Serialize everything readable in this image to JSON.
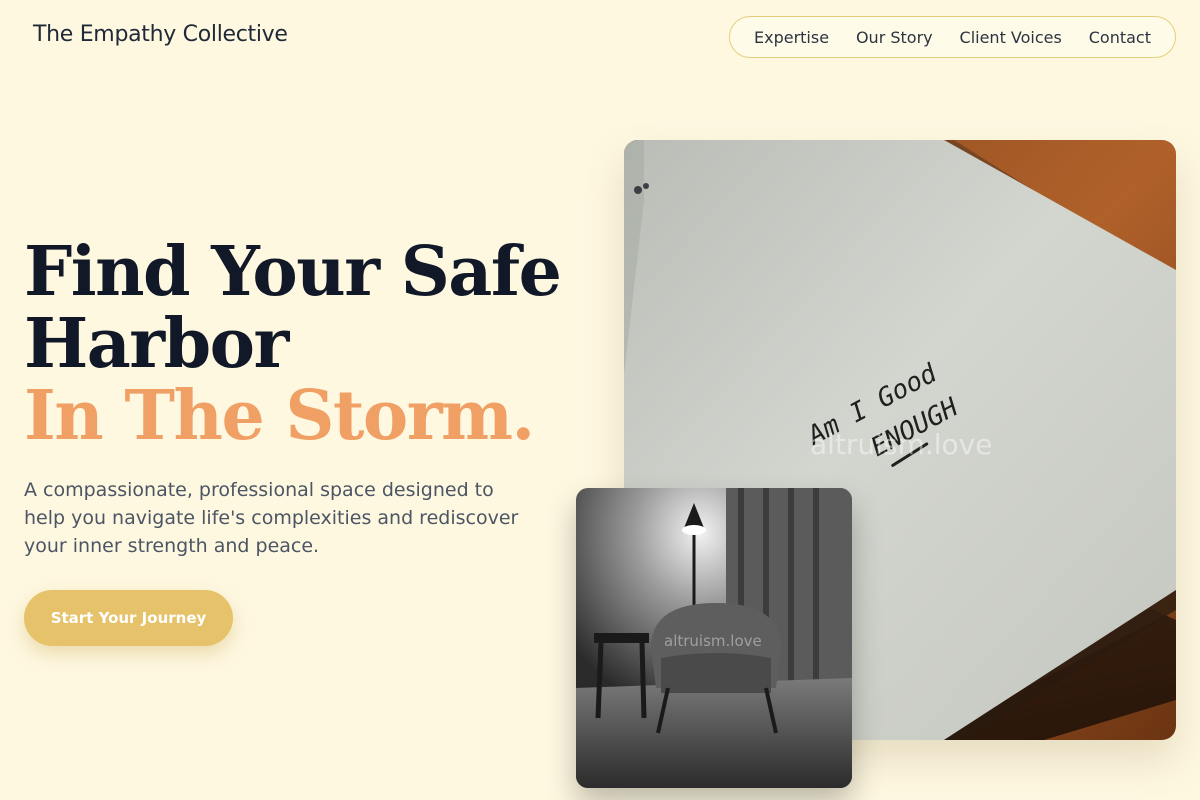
{
  "brand": {
    "name": "The Empathy Collective"
  },
  "nav": {
    "items": [
      {
        "label": "Expertise"
      },
      {
        "label": "Our Story"
      },
      {
        "label": "Client Voices"
      },
      {
        "label": "Contact"
      }
    ]
  },
  "hero": {
    "headline_line1": "Find Your Safe",
    "headline_line2": "Harbor",
    "headline_accent": "In The Storm.",
    "subtext": "A compassionate, professional space designed to help you navigate life's complexities and rediscover your inner strength and peace.",
    "cta_label": "Start Your Journey"
  },
  "images": {
    "main_handwriting_line1": "Am I Good",
    "main_handwriting_line2": "ENOUGH",
    "main_watermark": "altruism.love",
    "small_watermark": "altruism.love"
  },
  "colors": {
    "background": "#fef8e1",
    "accent": "#f0a064",
    "button": "#e6c36a",
    "nav_border": "#e5cf7e",
    "headline": "#111827"
  }
}
